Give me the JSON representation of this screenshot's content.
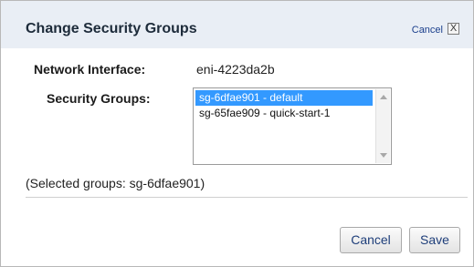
{
  "dialog": {
    "title": "Change Security Groups",
    "cancel_link": "Cancel",
    "close_glyph": "X"
  },
  "network_interface": {
    "label": "Network Interface:",
    "value": "eni-4223da2b"
  },
  "security_groups": {
    "label": "Security Groups:",
    "options": [
      {
        "text": "sg-6dfae901 - default",
        "selected": true
      },
      {
        "text": "sg-65fae909 - quick-start-1",
        "selected": false
      }
    ]
  },
  "selected_summary": "(Selected groups: sg-6dfae901)",
  "buttons": {
    "cancel": "Cancel",
    "save": "Save"
  },
  "colors": {
    "title_bar": "#e9eef5",
    "selection": "#3399ff",
    "link": "#1b3f8c"
  },
  "icons": {
    "close": "close-icon",
    "scroll_up": "chevron-up-icon",
    "scroll_down": "chevron-down-icon"
  }
}
